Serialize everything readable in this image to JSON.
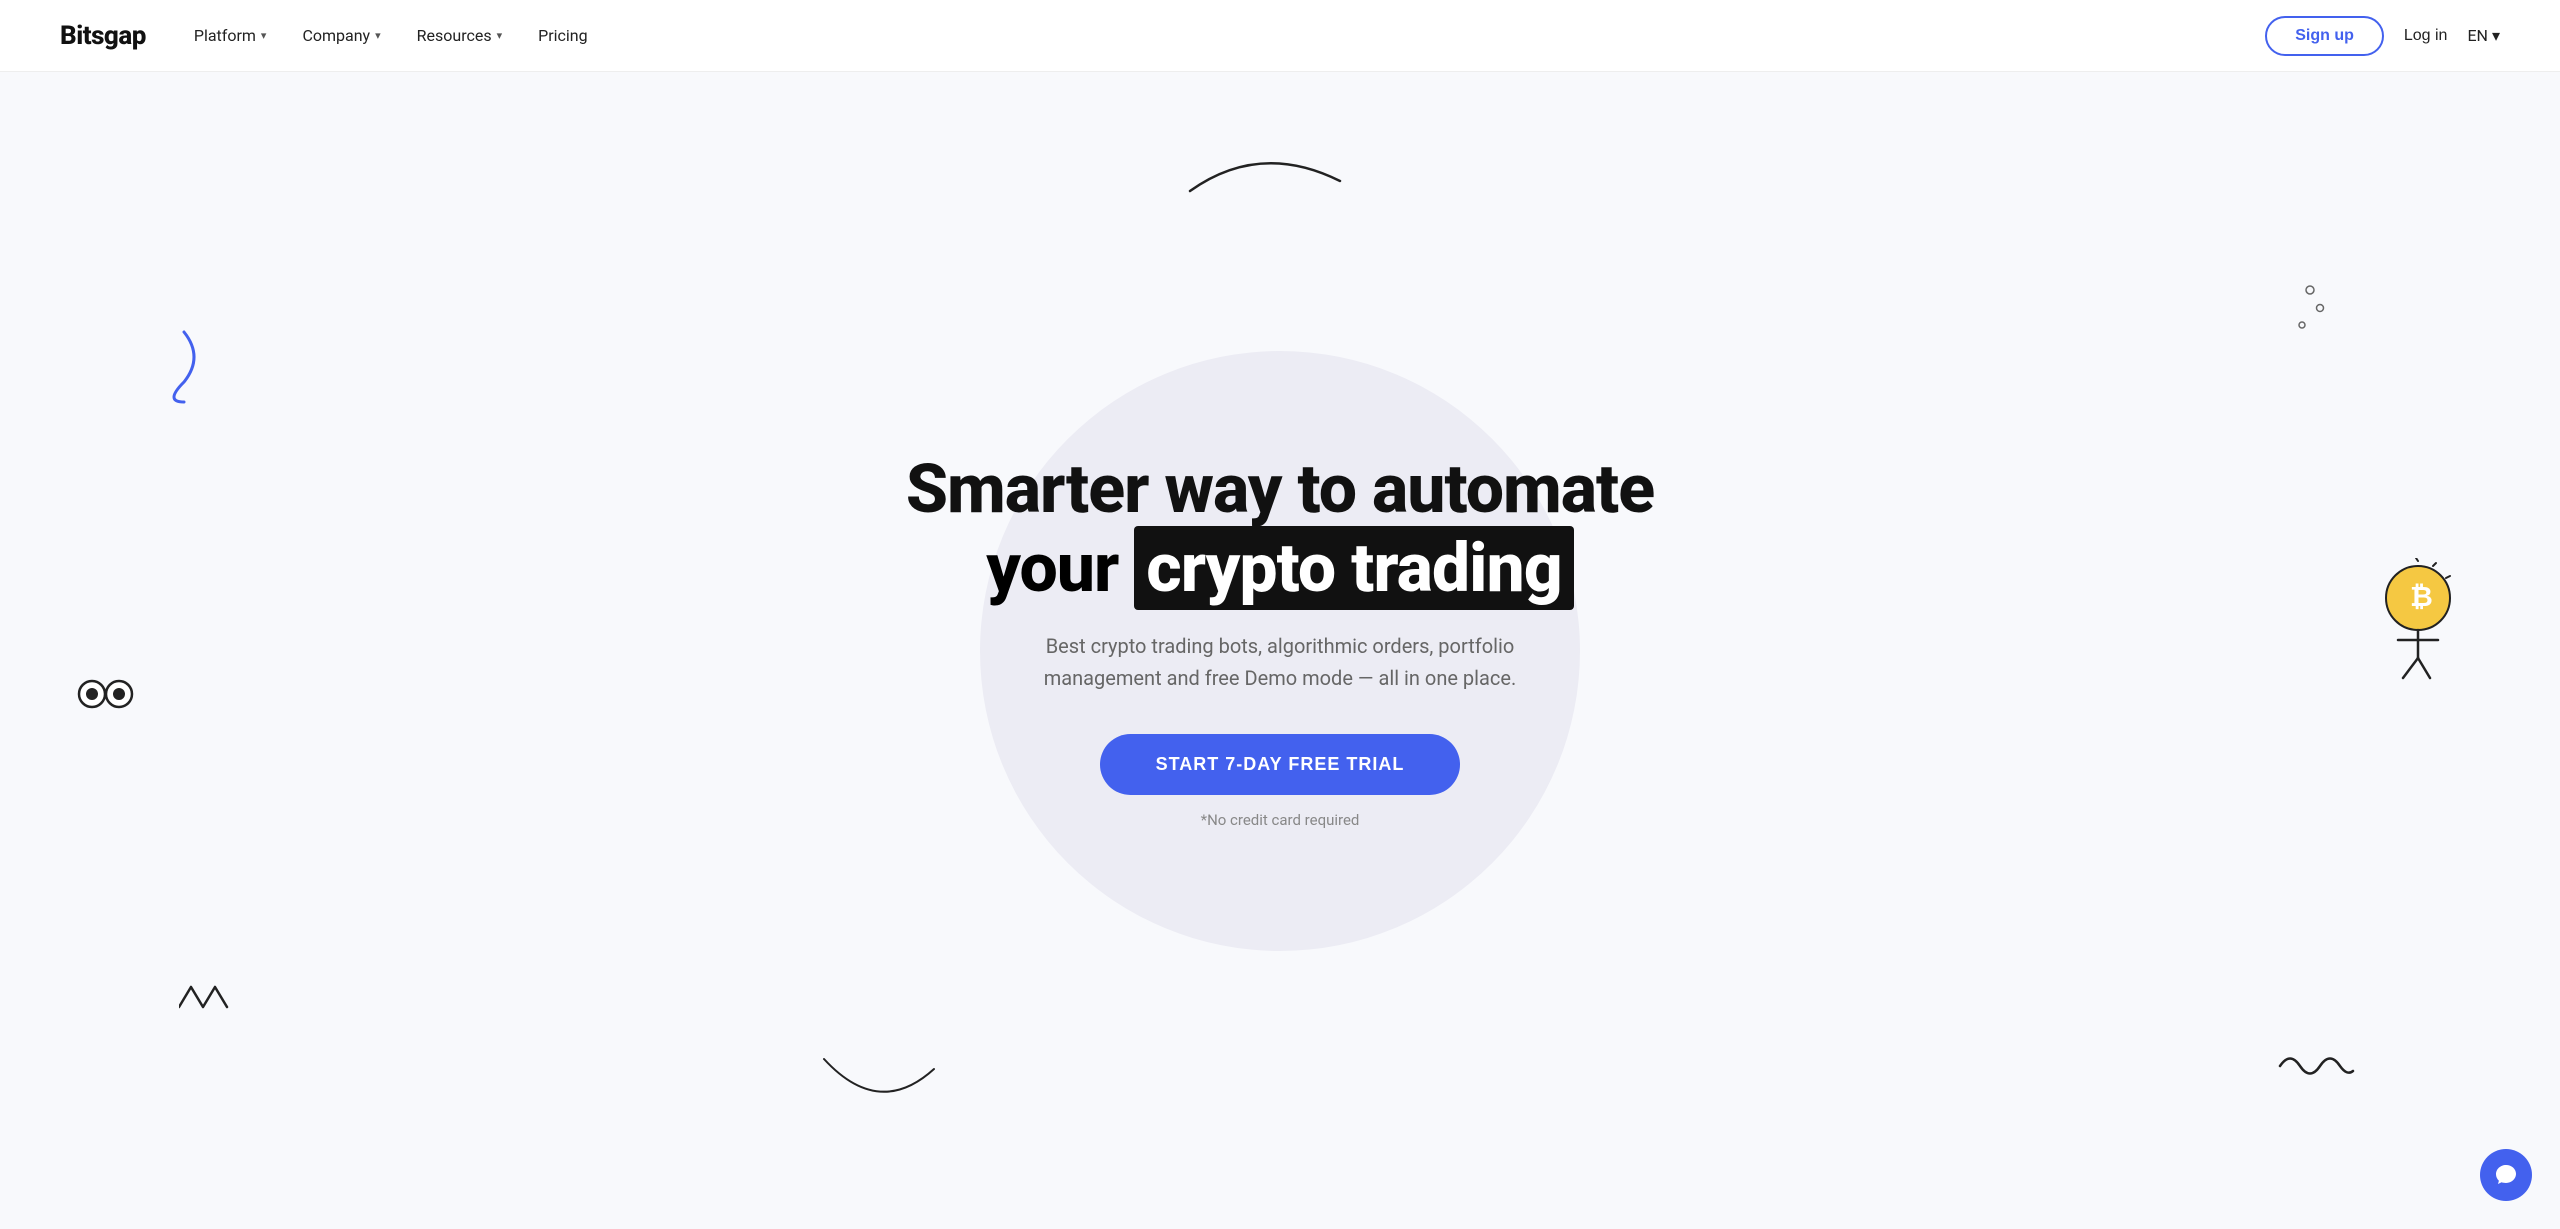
{
  "nav": {
    "logo": "Bitsgap",
    "links": [
      {
        "label": "Platform",
        "has_dropdown": true
      },
      {
        "label": "Company",
        "has_dropdown": true
      },
      {
        "label": "Resources",
        "has_dropdown": true
      },
      {
        "label": "Pricing",
        "has_dropdown": false
      }
    ],
    "signup_label": "Sign up",
    "login_label": "Log in",
    "lang_label": "EN"
  },
  "hero": {
    "title_line1": "Smarter way to automate",
    "title_line2_plain": "your ",
    "title_line2_highlight": "crypto trading",
    "subtitle": "Best crypto trading bots, algorithmic orders, portfolio management and free Demo mode — all in one place.",
    "cta_label": "START 7-DAY FREE TRIAL",
    "no_credit_label": "*No credit card required"
  }
}
